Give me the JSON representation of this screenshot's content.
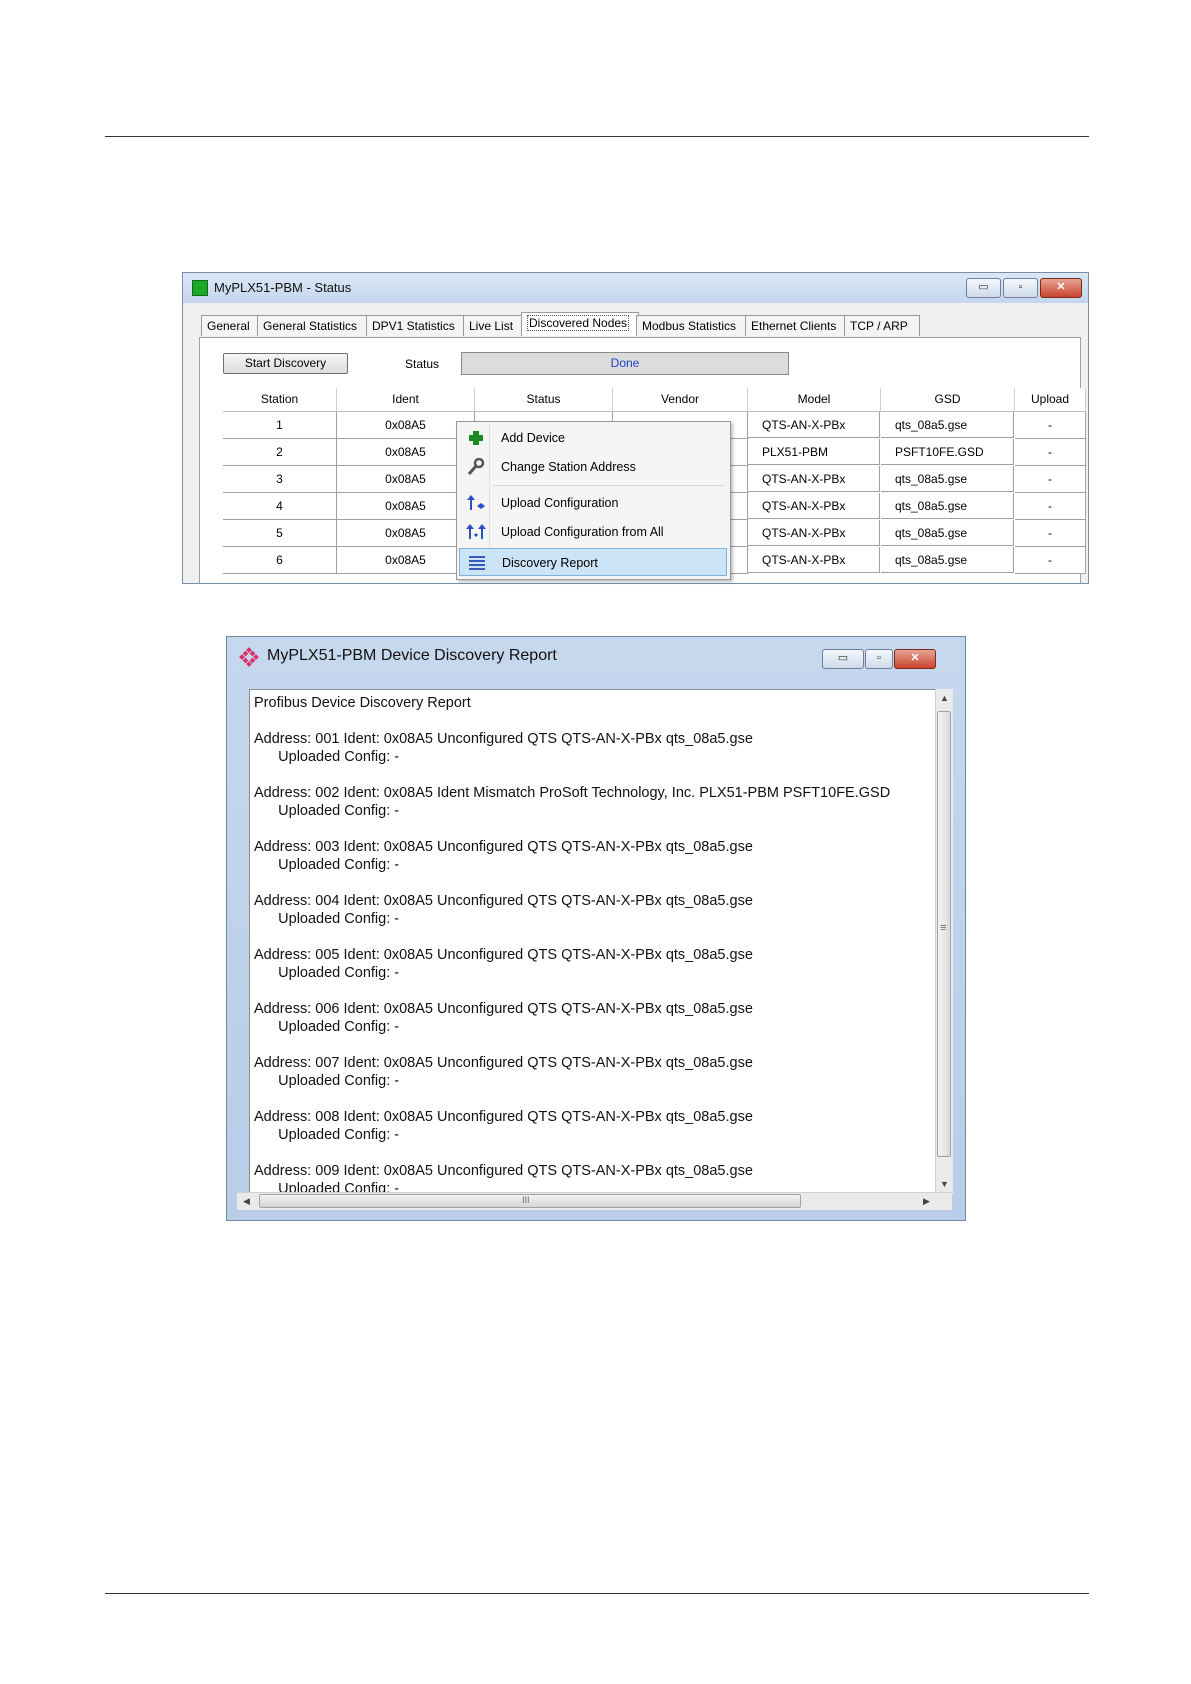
{
  "status_window": {
    "title": "MyPLX51-PBM - Status",
    "buttons": {
      "minimize": "▭",
      "maximize": "▫",
      "close": "✕"
    },
    "tabs": [
      "General",
      "General Statistics",
      "DPV1 Statistics",
      "Live List",
      "Discovered Nodes",
      "Modbus Statistics",
      "Ethernet Clients",
      "TCP / ARP"
    ],
    "active_tab": "Discovered Nodes",
    "start_discovery_label": "Start Discovery",
    "status_label": "Status",
    "status_value": "Done",
    "columns": [
      "Station",
      "Ident",
      "Status",
      "Vendor",
      "Model",
      "GSD",
      "Upload"
    ],
    "rows": [
      {
        "station": "1",
        "ident": "0x08A5",
        "model": "QTS-AN-X-PBx",
        "gsd": "qts_08a5.gse",
        "upload": "-"
      },
      {
        "station": "2",
        "ident": "0x08A5",
        "model": "PLX51-PBM",
        "gsd": "PSFT10FE.GSD",
        "upload": "-"
      },
      {
        "station": "3",
        "ident": "0x08A5",
        "model": "QTS-AN-X-PBx",
        "gsd": "qts_08a5.gse",
        "upload": "-"
      },
      {
        "station": "4",
        "ident": "0x08A5",
        "model": "QTS-AN-X-PBx",
        "gsd": "qts_08a5.gse",
        "upload": "-"
      },
      {
        "station": "5",
        "ident": "0x08A5",
        "model": "QTS-AN-X-PBx",
        "gsd": "qts_08a5.gse",
        "upload": "-"
      },
      {
        "station": "6",
        "ident": "0x08A5",
        "model": "QTS-AN-X-PBx",
        "gsd": "qts_08a5.gse",
        "upload": "-"
      }
    ],
    "context_menu": {
      "add_device": "Add Device",
      "change_station_address": "Change Station Address",
      "upload_configuration": "Upload Configuration",
      "upload_configuration_from_all": "Upload Configuration from All",
      "discovery_report": "Discovery Report"
    },
    "colors": {
      "status_ok": "#1fa82a",
      "done_text": "#1e3fc8",
      "menu_highlight": "#cce4f7"
    }
  },
  "report_window": {
    "title": "MyPLX51-PBM Device Discovery Report",
    "buttons": {
      "minimize": "▭",
      "maximize": "▫",
      "close": "✕"
    },
    "scroll_grip": "≡",
    "hscroll_grip": "III",
    "report_text": "Profibus Device Discovery Report\n\nAddress: 001 Ident: 0x08A5 Unconfigured QTS QTS-AN-X-PBx qts_08a5.gse\n      Uploaded Config: -\n\nAddress: 002 Ident: 0x08A5 Ident Mismatch ProSoft Technology, Inc. PLX51-PBM PSFT10FE.GSD\n      Uploaded Config: -\n\nAddress: 003 Ident: 0x08A5 Unconfigured QTS QTS-AN-X-PBx qts_08a5.gse\n      Uploaded Config: -\n\nAddress: 004 Ident: 0x08A5 Unconfigured QTS QTS-AN-X-PBx qts_08a5.gse\n      Uploaded Config: -\n\nAddress: 005 Ident: 0x08A5 Unconfigured QTS QTS-AN-X-PBx qts_08a5.gse\n      Uploaded Config: -\n\nAddress: 006 Ident: 0x08A5 Unconfigured QTS QTS-AN-X-PBx qts_08a5.gse\n      Uploaded Config: -\n\nAddress: 007 Ident: 0x08A5 Unconfigured QTS QTS-AN-X-PBx qts_08a5.gse\n      Uploaded Config: -\n\nAddress: 008 Ident: 0x08A5 Unconfigured QTS QTS-AN-X-PBx qts_08a5.gse\n      Uploaded Config: -\n\nAddress: 009 Ident: 0x08A5 Unconfigured QTS QTS-AN-X-PBx qts_08a5.gse\n      Uploaded Config: -",
    "colors": {
      "logo": "#d9306a"
    }
  }
}
